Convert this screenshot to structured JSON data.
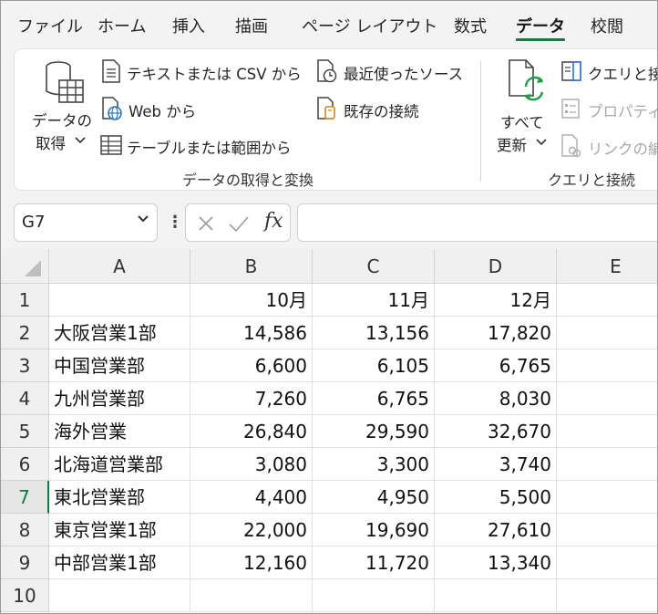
{
  "ribbon_tabs": [
    "ファイル",
    "ホーム",
    "挿入",
    "描画",
    "ページ レイアウト",
    "数式",
    "データ",
    "校閲"
  ],
  "active_tab": "データ",
  "get_data_group": {
    "get_data_label_line1": "データの",
    "get_data_label_line2": "取得",
    "from_text_csv": "テキストまたは CSV から",
    "from_web": "Web から",
    "from_table_range": "テーブルまたは範囲から",
    "recent_sources": "最近使ったソース",
    "existing_connections": "既存の接続",
    "group_label": "データの取得と変換"
  },
  "queries_group": {
    "refresh_all_line1": "すべて",
    "refresh_all_line2": "更新",
    "queries_connections": "クエリと接続",
    "properties": "プロパティ",
    "edit_links": "リンクの編集",
    "group_label": "クエリと接続"
  },
  "formula_bar": {
    "name_box": "G7",
    "fx_label": "fx",
    "formula_value": ""
  },
  "columns": [
    "A",
    "B",
    "C",
    "D",
    "E"
  ],
  "rows": [
    {
      "num": "1",
      "cells": [
        "",
        "10月",
        "11月",
        "12月",
        ""
      ]
    },
    {
      "num": "2",
      "cells": [
        "大阪営業1部",
        "14,586",
        "13,156",
        "17,820",
        ""
      ]
    },
    {
      "num": "3",
      "cells": [
        "中国営業部",
        "6,600",
        "6,105",
        "6,765",
        ""
      ]
    },
    {
      "num": "4",
      "cells": [
        "九州営業部",
        "7,260",
        "6,765",
        "8,030",
        ""
      ]
    },
    {
      "num": "5",
      "cells": [
        "海外営業",
        "26,840",
        "29,590",
        "32,670",
        ""
      ]
    },
    {
      "num": "6",
      "cells": [
        "北海道営業部",
        "3,080",
        "3,300",
        "3,740",
        ""
      ]
    },
    {
      "num": "7",
      "cells": [
        "東北営業部",
        "4,400",
        "4,950",
        "5,500",
        ""
      ]
    },
    {
      "num": "8",
      "cells": [
        "東京営業1部",
        "22,000",
        "19,690",
        "27,610",
        ""
      ]
    },
    {
      "num": "9",
      "cells": [
        "中部営業1部",
        "12,160",
        "11,720",
        "13,340",
        ""
      ]
    },
    {
      "num": "10",
      "cells": [
        "",
        "",
        "",
        "",
        ""
      ]
    }
  ],
  "selected_row": "7",
  "colors": {
    "accent_green": "#217346",
    "selected_header_green": "#107c41"
  }
}
